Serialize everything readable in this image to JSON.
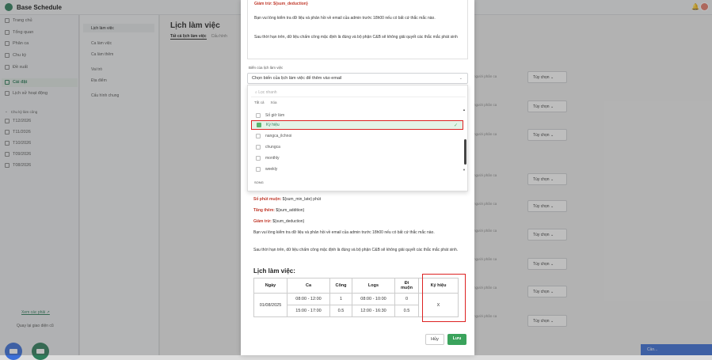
{
  "app": {
    "title": "Base Schedule"
  },
  "sidebar": {
    "items": [
      {
        "label": "Trang chủ",
        "icon": "home-icon"
      },
      {
        "label": "Tổng quan",
        "icon": "grid-icon"
      },
      {
        "label": "Phân ca",
        "icon": "shift-icon"
      },
      {
        "label": "Chu kỳ",
        "icon": "cycle-icon"
      },
      {
        "label": "Đề xuất",
        "icon": "request-icon"
      },
      {
        "label": "Cài đặt",
        "icon": "gear-icon"
      },
      {
        "label": "Lịch sử hoạt động",
        "icon": "history-icon"
      }
    ],
    "cycle_header": "Chu kỳ làm công",
    "cycles": [
      "T12/2026",
      "T11/2026",
      "T10/2026",
      "T09/2026",
      "T08/2026"
    ],
    "link": "Xem các phải ↗",
    "back": "Quay lại giao diện cũ"
  },
  "subnav": {
    "items": [
      "Lịch làm việc",
      "Ca làm việc",
      "Ca làm thêm",
      "Vai trò",
      "Địa điểm",
      "Cấu hình chung"
    ]
  },
  "content": {
    "title": "Lịch làm việc",
    "tabs": [
      "Tất cả lịch làm việc",
      "Cấu hình"
    ],
    "row_label": "người phân ca",
    "dropdown_label": "Tùy chọn",
    "minimized": "Cần..."
  },
  "modal": {
    "preview_top": {
      "deduction": "Giảm trừ: ${sum_deduction}",
      "para1": "Bạn vui lòng kiểm tra dữ liệu và phản hồi về email của admin trước 18h00 nếu có bất cứ thắc mắc nào.",
      "para2": "Sau thời hạn trên, dữ liệu chấm công mặc định là đúng và bộ phận C&B sẽ không giải quyết các thắc mắc phát sinh"
    },
    "field_label": "Biến của lịch làm việc",
    "select_placeholder": "Chọn biến của lịch làm việc để thêm vào email",
    "filter_placeholder": "Lọc nhanh",
    "select_all": "Tất cả",
    "clear": "Xóa",
    "options": [
      "Số giờ làm",
      "Ký hiệu",
      "nangca_ilchnoi",
      "chungca",
      "monthly",
      "weekly"
    ],
    "selected_option": "Ký hiệu",
    "dropdown_footer": "SONG",
    "preview_bottom": {
      "late": "Số phút muộn: ${sum_min_late} phút",
      "addition": "Tăng thêm: ${sum_addition}",
      "deduction": "Giảm trừ: ${sum_deduction}",
      "para1": "Bạn vui lòng kiểm tra dữ liệu và phản hồi về email của admin trước 18h00 nếu có bất cứ thắc mắc nào.",
      "para2": "Sau thời hạn trên, dữ liệu chấm công mặc định là đúng và bộ phận C&B sẽ không giải quyết các thắc mắc phát sinh."
    },
    "schedule_title": "Lịch làm việc:",
    "table": {
      "headers": [
        "Ngày",
        "Ca",
        "Công",
        "Logs",
        "Đi muộn",
        "Ký hiệu"
      ],
      "date": "01/08/2025",
      "rows": [
        {
          "ca": "08:00 - 12:00",
          "cong": "1",
          "logs": "08:00 - 10:00",
          "late": "0"
        },
        {
          "ca": "15:00 - 17:00",
          "cong": "0.5",
          "logs": "12:00 - 16:30",
          "late": "0.5"
        }
      ],
      "symbol": "X"
    },
    "cancel_label": "Hủy",
    "save_label": "Lưu"
  }
}
